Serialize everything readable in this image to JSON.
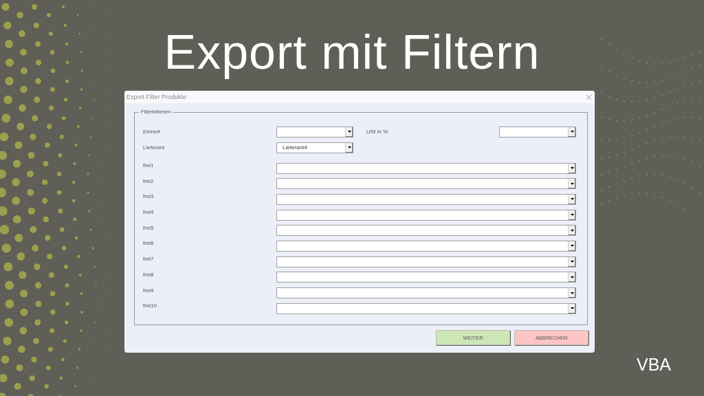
{
  "headline": "Export mit Filtern",
  "dialog": {
    "title": "Export Filter Produkte",
    "group": {
      "caption": "Filterkriterien",
      "top_rows": [
        [
          {
            "label": "Einheit"
          },
          {
            "label": "USt in %"
          }
        ],
        [
          {
            "label": "Lieferant",
            "value": "Lieferant4"
          }
        ]
      ],
      "free_fields": [
        {
          "label": "frei1"
        },
        {
          "label": "frei2"
        },
        {
          "label": "frei3"
        },
        {
          "label": "frei4"
        },
        {
          "label": "frei5"
        },
        {
          "label": "frei6"
        },
        {
          "label": "frei7"
        },
        {
          "label": "frei8"
        },
        {
          "label": "frei9"
        },
        {
          "label": "frei10"
        }
      ]
    },
    "buttons": [
      {
        "label": "WEITER",
        "kind": "confirm"
      },
      {
        "label": "ABBRECHEN",
        "kind": "cancel"
      }
    ]
  },
  "footer_label": "VBA"
}
